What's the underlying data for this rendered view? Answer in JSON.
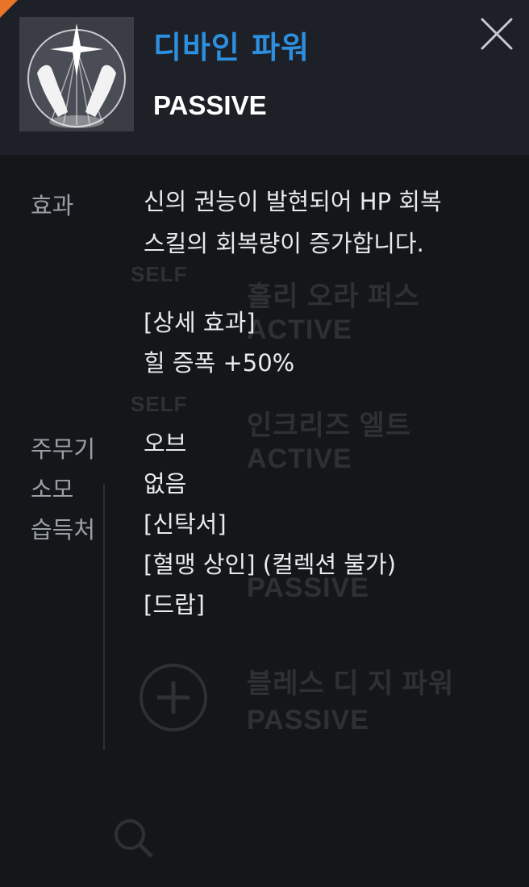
{
  "header": {
    "skill_name": "디바인 파워",
    "skill_type": "PASSIVE",
    "icon": "divine-power-skill-icon",
    "close_icon": "close-icon"
  },
  "details": {
    "effect_label": "효과",
    "effect_lines": [
      "신의 권능이 발현되어 HP 회복",
      "스킬의 회복량이 증가합니다."
    ],
    "detail_heading": "[상세 효과]",
    "detail_value": "힐 증폭 +50%",
    "weapon_label": "주무기",
    "weapon_value": "오브",
    "cost_label": "소모",
    "cost_value": "없음",
    "source_label": "습득처",
    "source_lines": [
      "[신탁서]",
      "[혈맹 상인] (컬렉션 불가)",
      "[드랍]"
    ]
  },
  "background_list": {
    "items": [
      {
        "tag": "SELF",
        "name": "홀리 오라 퍼스",
        "type": "ACTIVE"
      },
      {
        "tag": "SELF",
        "name": "인크리즈 엘트",
        "type": "ACTIVE"
      },
      {
        "tag": "",
        "name": "",
        "type": "PASSIVE"
      },
      {
        "tag": "",
        "name": "블레스 디 지 파워",
        "type": "PASSIVE"
      }
    ]
  },
  "colors": {
    "accent_blue": "#2d8fe0",
    "header_bg": "#1d2027",
    "body_bg": "#14161a",
    "label_gray": "#9aa0a8",
    "corner_orange": "#e8742a"
  }
}
